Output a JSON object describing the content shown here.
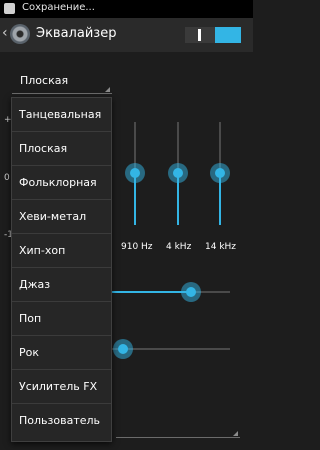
{
  "status_bar": {
    "text": "Сохранение..."
  },
  "action_bar": {
    "title": "Эквалайзер",
    "toggle_on": true
  },
  "preset_spinner": {
    "value": "Плоская"
  },
  "equalizer": {
    "edge_labels": [
      "+",
      "0",
      "-1"
    ],
    "bands": [
      {
        "label": "910 Hz"
      },
      {
        "label": "4 kHz"
      },
      {
        "label": "14 kHz"
      }
    ]
  },
  "slider_1": {
    "fraction": 0.66
  },
  "slider_2": {
    "fraction": 0.0
  },
  "preset_menu": {
    "items": [
      "Танцевальная",
      "Плоская",
      "Фольклорная",
      "Хеви-метал",
      "Хип-хоп",
      "Джаз",
      "Поп",
      "Рок",
      "Усилитель FX",
      "Пользователь"
    ]
  },
  "colors": {
    "accent": "#33b5e5",
    "background": "#1d1d1d",
    "action_bar": "#2a2a2a"
  }
}
